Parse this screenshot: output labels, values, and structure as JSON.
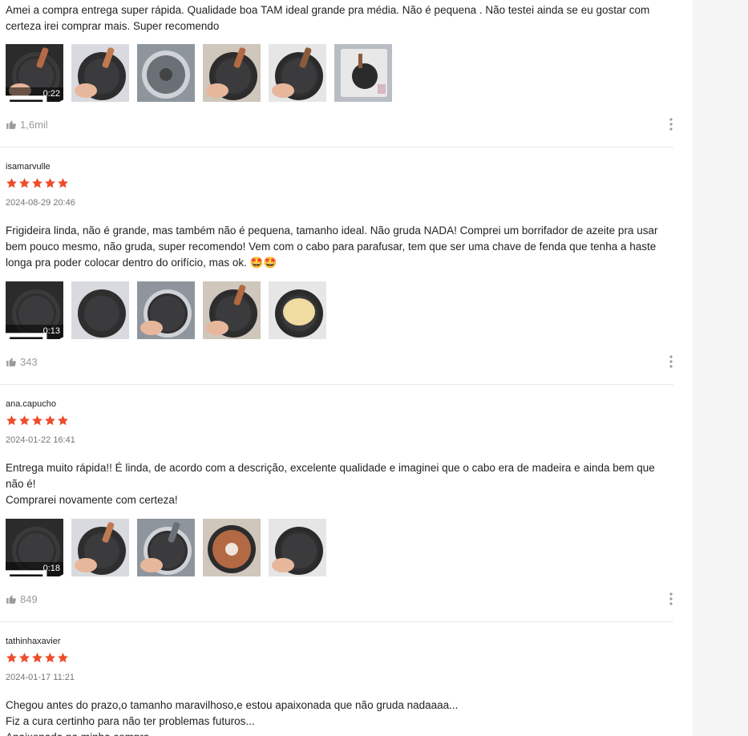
{
  "colors": {
    "star": "#ee4d2d",
    "divider": "#e8e8e8",
    "muted": "#9b9b9b",
    "gutter": "#f5f5f5"
  },
  "icons": {
    "star": "star-icon",
    "video": "video-camera-icon",
    "like": "thumbs-up-icon",
    "more": "more-vertical-icon"
  },
  "reviews": [
    {
      "author": "",
      "rating": 5,
      "date": "",
      "text": "Amei a compra entrega super rápida.  Qualidade boa TAM ideal grande pra média.  Não é pequena  . Não testei ainda se eu gostar com certeza irei comprar mais.  Super recomendo",
      "video_duration": "0:22",
      "media": [
        "video-frying-pan-held",
        "pan-with-wooden-handle",
        "pan-granite-interior",
        "pan-handle-closeup",
        "pan-held-in-hand",
        "pan-in-packaging"
      ],
      "likes": "1,6mil"
    },
    {
      "author": "isamarvulle",
      "rating": 5,
      "date": "2024-08-29 20:46",
      "text": "Frigideira linda, não é grande, mas também não é pequena, tamanho ideal. Não gruda NADA! Comprei um borrifador de azeite pra usar bem pouco mesmo, não gruda, super recomendo! Vem com o cabo para parafusar, tem que ser uma chave de fenda que tenha a haste longa pra poder colocar dentro do orifício, mas ok. 🤩🤩",
      "video_duration": "0:13",
      "media": [
        "video-pan-top-view",
        "pan-on-stove",
        "hand-on-pan",
        "pan-held-handle",
        "pan-with-crepe"
      ],
      "likes": "343"
    },
    {
      "author": "ana.capucho",
      "rating": 5,
      "date": "2024-01-22 16:41",
      "text": "Entrega muito rápida!! É linda, de acordo com a descrição, excelente qualidade e imaginei que o cabo era de madeira e ainda bem que não é!\nComprarei novamente com certeza!",
      "video_duration": "0:18",
      "media": [
        "video-pan-top-view",
        "pan-with-handle",
        "pan-handle-held",
        "pan-underside",
        "hand-on-pan-interior"
      ],
      "likes": "849"
    },
    {
      "author": "tathinhaxavier",
      "rating": 5,
      "date": "2024-01-17 11:21",
      "text": "Chegou antes do prazo,o tamanho maravilhoso,e estou apaixonada que não gruda nadaaaa...\nFiz a cura certinho para não ter problemas futuros...\nApaixonada na minha compra",
      "video_duration": "",
      "media": [],
      "likes": ""
    }
  ]
}
